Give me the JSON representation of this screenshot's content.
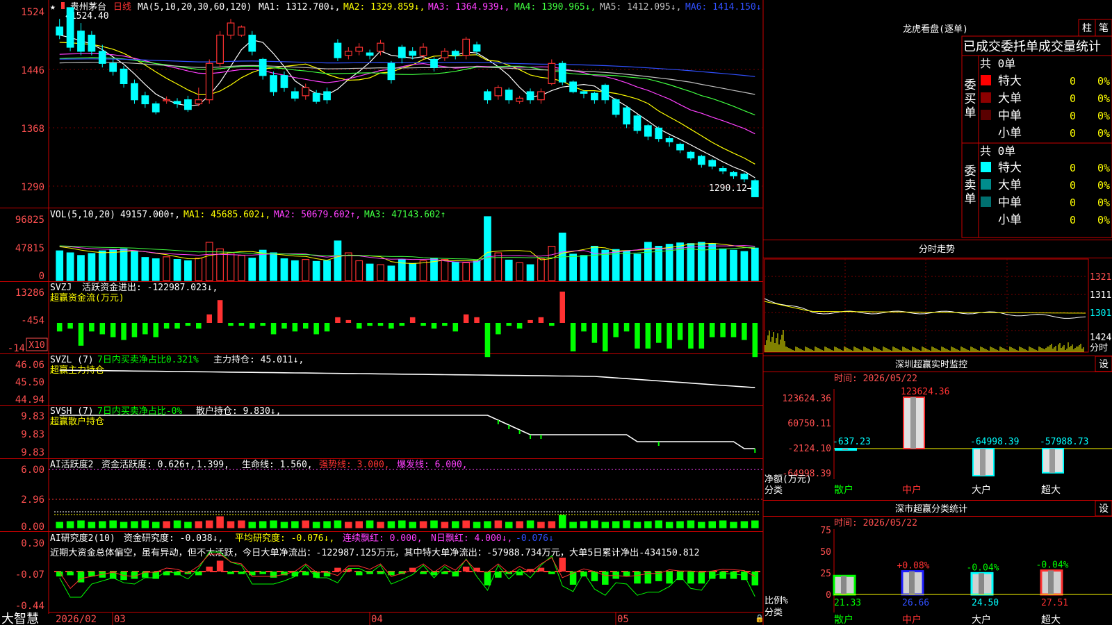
{
  "colors": {
    "up": "#ff3232",
    "down": "#00ffff",
    "text": "#ffffff",
    "grid": "#cc0000",
    "axis": "#ff5050",
    "yellow": "#ffff00",
    "green": "#00ff00",
    "magenta": "#ff00ff",
    "blue": "#3050ff",
    "gray": "#c0c0c0",
    "pink": "#ff40ff"
  },
  "brand": "大智慧",
  "kline": {
    "stock": "贵州茅台",
    "period": "日线",
    "ma_label": "MA(5,10,20,30,60,120)",
    "ma1": "MA1: 1312.700↓,",
    "ma2": "MA2: 1329.859↓,",
    "ma3": "MA3: 1364.939↓,",
    "ma4": "MA4: 1390.965↓,",
    "ma5": "MA5: 1412.095↓,",
    "ma6": "MA6: 1414.150↓",
    "star": "★",
    "high_note": "←1524.40",
    "low_note": "1290.12→",
    "y_ticks": [
      "1524",
      "1446",
      "1368",
      "1290"
    ]
  },
  "vol": {
    "label": "VOL(5,10,20)",
    "value": "49157.000↑,",
    "ma1": "MA1: 45685.602↓,",
    "ma2": "MA2: 50679.602↑,",
    "ma3": "MA3: 47143.602↑",
    "y_ticks": [
      "96825",
      "47815",
      "0"
    ]
  },
  "svzj": {
    "label": "SVZJ",
    "title": "活跃资金进出: -122987.023↓,",
    "sub": "超赢资金流(万元)",
    "y_ticks": [
      "13286",
      "-454",
      "-14"
    ],
    "badge": "X10"
  },
  "svzl": {
    "label": "SVZL (7)",
    "ratio": "7日内买卖净占比0.321%",
    "hold": "主力持仓: 45.011↓,",
    "sub": "超赢主力持仓",
    "y_ticks": [
      "46.06",
      "45.50",
      "44.94"
    ]
  },
  "svsh": {
    "label": "SVSH (7)",
    "ratio": "7日内买卖净占比-0%",
    "hold": "散户持仓: 9.830↓,",
    "sub": "超赢散户持仓",
    "y_ticks": [
      "9.83",
      "9.83",
      "9.83"
    ]
  },
  "ai1": {
    "label": "AI活跃度2",
    "t1": "资金活跃度: 0.626↑,",
    "t2": "1.399,",
    "t3": "生命线: 1.560,",
    "t4": "强势线: 3.000,",
    "t5": "爆发线: 6.000,",
    "y_ticks": [
      "6.00",
      "2.96",
      "0.00"
    ]
  },
  "ai2": {
    "label": "AI研究度2(10)",
    "t1": "资金研究度: -0.038↓,",
    "t2": "平均研究度: -0.076↓,",
    "t3": "连续飘红: 0.000,",
    "t4": "N日飘红: 4.000↓,",
    "t5": "-0.076↓",
    "desc": "近期大资金总体偏空，虽有异动，但不太活跃，今日大单净流出：-122987.125万元，其中特大单净流出：-57988.734万元，大单5日累计净出-434150.812",
    "y_ticks": [
      "0.30",
      "-0.07",
      "-0.44"
    ]
  },
  "xaxis": [
    "2026/02",
    "03",
    "04",
    "05"
  ],
  "lhb": {
    "title": "龙虎看盘(逐单)",
    "btn_bar": "柱",
    "btn_pen": "笔",
    "heading": "已成交委托单成交量统计",
    "buy_side": "委买单",
    "sell_side": "委卖单",
    "buy_total": "共 0单",
    "sell_total": "共 0单",
    "buy_rows": [
      {
        "name": "特大",
        "count": "0",
        "pct": "0%",
        "color": "#ff0000"
      },
      {
        "name": "大单",
        "count": "0",
        "pct": "0%",
        "color": "#8c0000"
      },
      {
        "name": "中单",
        "count": "0",
        "pct": "0%",
        "color": "#5a0000"
      },
      {
        "name": "小单",
        "count": "0",
        "pct": "0%",
        "color": ""
      }
    ],
    "sell_rows": [
      {
        "name": "特大",
        "count": "0",
        "pct": "0%",
        "color": "#00ffff"
      },
      {
        "name": "大单",
        "count": "0",
        "pct": "0%",
        "color": "#008c8c"
      },
      {
        "name": "中单",
        "count": "0",
        "pct": "0%",
        "color": "#007070"
      },
      {
        "name": "小单",
        "count": "0",
        "pct": "0%",
        "color": ""
      }
    ]
  },
  "intraday": {
    "title": "分时走势",
    "y_ticks": [
      "1321",
      "1311",
      "1301"
    ],
    "vol_tick": "1424",
    "unit": "分时"
  },
  "monitor": {
    "title": "深圳超赢实时监控",
    "btn": "设",
    "time": "时间: 2026/05/22",
    "y_ticks": [
      "123624.36",
      "60750.11",
      "-2124.10",
      "-64998.39"
    ],
    "ylabel": "净额(万元)",
    "xlabel": "分类",
    "categories": [
      "散户",
      "中户",
      "大户",
      "超大"
    ],
    "values": [
      "-637.23",
      "123624.36",
      "-64998.39",
      "-57988.73"
    ]
  },
  "classify": {
    "title": "深市超赢分类统计",
    "btn": "设",
    "time": "时间: 2026/05/22",
    "y_ticks": [
      "75",
      "50",
      "25",
      "0"
    ],
    "ylabel": "比例%",
    "xlabel": "分类",
    "categories": [
      "散户",
      "中户",
      "大户",
      "超大"
    ],
    "values": [
      "21.33",
      "26.66",
      "24.50",
      "27.51"
    ],
    "changes": [
      "",
      "+0.08%",
      "-0.04%",
      "-0.04%"
    ]
  },
  "chart_data": [
    {
      "type": "candlestick",
      "ylim": [
        1290,
        1524
      ],
      "open": [
        1500,
        1524,
        1495,
        1490,
        1470,
        1455,
        1448,
        1430,
        1415,
        1405,
        1410,
        1408,
        1410,
        1405,
        1410,
        1455,
        1490,
        1490,
        1490,
        1460,
        1440,
        1440,
        1420,
        1415,
        1418,
        1420,
        1480,
        1465,
        1470,
        1468,
        1470,
        1455,
        1475,
        1470,
        1465,
        1460,
        1462,
        1470,
        1465,
        1478,
        1420,
        1415,
        1422,
        1408,
        1420,
        1410,
        1430,
        1455,
        1432,
        1420,
        1418,
        1428,
        1410,
        1400,
        1390,
        1378,
        1375,
        1362,
        1355,
        1345,
        1340,
        1335,
        1325,
        1320,
        1318,
        1310
      ],
      "close": [
        1490,
        1475,
        1470,
        1470,
        1455,
        1445,
        1430,
        1410,
        1405,
        1395,
        1410,
        1405,
        1398,
        1410,
        1455,
        1490,
        1505,
        1500,
        1470,
        1440,
        1420,
        1425,
        1412,
        1425,
        1408,
        1410,
        1462,
        1470,
        1475,
        1465,
        1480,
        1435,
        1462,
        1465,
        1475,
        1450,
        1470,
        1465,
        1485,
        1470,
        1410,
        1425,
        1410,
        1412,
        1410,
        1420,
        1455,
        1432,
        1420,
        1418,
        1410,
        1410,
        1392,
        1380,
        1372,
        1365,
        1362,
        1358,
        1348,
        1338,
        1330,
        1328,
        1322,
        1316,
        1312,
        1290
      ],
      "high": [
        1510,
        1524,
        1505,
        1495,
        1478,
        1460,
        1452,
        1435,
        1420,
        1408,
        1414,
        1412,
        1415,
        1425,
        1460,
        1495,
        1510,
        1502,
        1495,
        1462,
        1445,
        1445,
        1425,
        1430,
        1422,
        1425,
        1485,
        1475,
        1480,
        1472,
        1484,
        1458,
        1478,
        1475,
        1480,
        1463,
        1474,
        1472,
        1488,
        1482,
        1423,
        1428,
        1425,
        1415,
        1424,
        1424,
        1460,
        1458,
        1434,
        1422,
        1420,
        1430,
        1412,
        1402,
        1392,
        1380,
        1377,
        1365,
        1357,
        1347,
        1342,
        1337,
        1328,
        1322,
        1320,
        1312
      ],
      "low": [
        1485,
        1470,
        1465,
        1465,
        1450,
        1440,
        1425,
        1405,
        1400,
        1392,
        1405,
        1400,
        1395,
        1402,
        1405,
        1450,
        1485,
        1488,
        1465,
        1435,
        1415,
        1420,
        1408,
        1410,
        1405,
        1405,
        1458,
        1460,
        1465,
        1460,
        1465,
        1430,
        1455,
        1460,
        1460,
        1445,
        1458,
        1460,
        1460,
        1465,
        1405,
        1410,
        1405,
        1405,
        1405,
        1405,
        1428,
        1428,
        1418,
        1412,
        1405,
        1405,
        1388,
        1375,
        1368,
        1360,
        1358,
        1352,
        1344,
        1335,
        1326,
        1324,
        1318,
        1312,
        1308,
        1290
      ]
    },
    {
      "type": "bar",
      "name": "VOL",
      "ylim": [
        0,
        96825
      ],
      "values": [
        45000,
        42000,
        38000,
        41000,
        45000,
        47000,
        48000,
        44000,
        35000,
        33000,
        36000,
        32000,
        30000,
        34000,
        58000,
        48000,
        42000,
        38000,
        34000,
        46000,
        42000,
        33000,
        30000,
        32000,
        29000,
        30000,
        60000,
        42000,
        30000,
        25000,
        24000,
        22000,
        32000,
        26000,
        30000,
        34000,
        32000,
        28000,
        27000,
        30000,
        96825,
        42000,
        31000,
        27000,
        24000,
        33000,
        52000,
        72000,
        40000,
        38000,
        52000,
        46000,
        47000,
        45000,
        40000,
        58000,
        52000,
        55000,
        57000,
        56000,
        58000,
        56000,
        48000,
        46000,
        44000,
        49157
      ]
    },
    {
      "type": "bar",
      "name": "SVZJ",
      "ylim": [
        -14,
        13286
      ],
      "values": [
        -3,
        -2,
        -8,
        -3,
        -4,
        -5,
        -6,
        -5,
        -4,
        -5,
        -2,
        -2,
        -1,
        -2,
        3,
        8,
        -1,
        -1,
        -2,
        -1,
        -4,
        -2,
        -3,
        -2,
        -4,
        -3,
        2,
        1,
        -2,
        -1,
        -1,
        -2,
        -1,
        2,
        -1,
        -2,
        -1,
        -3,
        3,
        2,
        -12,
        -4,
        -1,
        -2,
        1,
        2,
        -1,
        11,
        -10,
        -3,
        -7,
        -10,
        -5,
        -3,
        -9,
        -9,
        -7,
        -9,
        -6,
        -9,
        -9,
        -5,
        -5,
        -5,
        -6,
        -12
      ]
    },
    {
      "type": "line",
      "name": "SVZL",
      "ylim": [
        44.94,
        46.06
      ]
    },
    {
      "type": "line",
      "name": "SVSH",
      "ylim": [
        9.83,
        9.83
      ]
    },
    {
      "type": "bar",
      "name": "AI活跃度2",
      "ylim": [
        0,
        6
      ]
    },
    {
      "type": "bar",
      "name": "AI研究度2",
      "ylim": [
        -0.44,
        0.3
      ]
    },
    {
      "type": "bar",
      "name": "深圳超赢实时监控",
      "categories": [
        "散户",
        "中户",
        "大户",
        "超大"
      ],
      "values": [
        -637.23,
        123624.36,
        -64998.39,
        -57988.73
      ],
      "ylim": [
        -64998.39,
        123624.36
      ]
    },
    {
      "type": "bar",
      "name": "深市超赢分类统计",
      "categories": [
        "散户",
        "中户",
        "大户",
        "超大"
      ],
      "values": [
        21.33,
        26.66,
        24.5,
        27.51
      ],
      "ylim": [
        0,
        75
      ]
    }
  ]
}
